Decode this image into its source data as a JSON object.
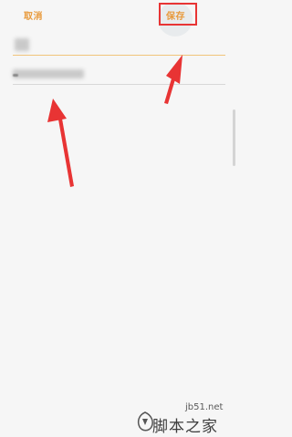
{
  "toolbar": {
    "cancel_label": "取消",
    "save_label": "保存"
  },
  "watermark": {
    "url": "jb51.net",
    "name": "脚本之家"
  },
  "colors": {
    "accent": "#e89a3c",
    "annotation": "#e83434",
    "active_underline": "#f0c47a"
  }
}
